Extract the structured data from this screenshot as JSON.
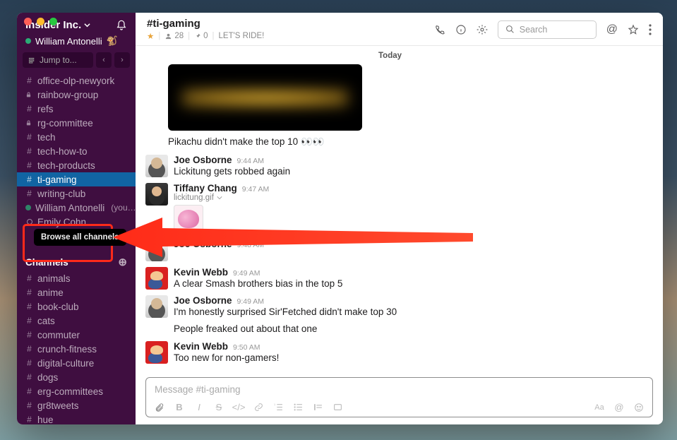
{
  "workspace": {
    "name": "Insider Inc.",
    "user": "William Antonelli"
  },
  "jump": {
    "placeholder": "Jump to..."
  },
  "sidebar_top": [
    {
      "prefix": "#",
      "name": "office-olp-newyork"
    },
    {
      "prefix": "lock",
      "name": "rainbow-group"
    },
    {
      "prefix": "#",
      "name": "refs"
    },
    {
      "prefix": "lock",
      "name": "rg-committee"
    },
    {
      "prefix": "#",
      "name": "tech"
    },
    {
      "prefix": "#",
      "name": "tech-how-to"
    },
    {
      "prefix": "#",
      "name": "tech-products"
    },
    {
      "prefix": "#",
      "name": "ti-gaming",
      "active": true
    },
    {
      "prefix": "#",
      "name": "writing-club"
    },
    {
      "prefix": "presence",
      "name": "William Antonelli",
      "suffix": "(you…  🐒"
    },
    {
      "prefix": "away",
      "name": "Emily Cohn"
    }
  ],
  "tooltip": "Browse all channels",
  "channels_header": "Channels",
  "sidebar_channels": [
    {
      "prefix": "#",
      "name": "animals"
    },
    {
      "prefix": "#",
      "name": "anime"
    },
    {
      "prefix": "#",
      "name": "book-club"
    },
    {
      "prefix": "#",
      "name": "cats"
    },
    {
      "prefix": "#",
      "name": "commuter"
    },
    {
      "prefix": "#",
      "name": "crunch-fitness"
    },
    {
      "prefix": "#",
      "name": "digital-culture"
    },
    {
      "prefix": "#",
      "name": "dogs"
    },
    {
      "prefix": "#",
      "name": "erg-committees"
    },
    {
      "prefix": "#",
      "name": "gr8tweets"
    },
    {
      "prefix": "#",
      "name": "hue"
    }
  ],
  "channel": {
    "title": "#ti-gaming",
    "members": "28",
    "pins": "0",
    "topic": "LET'S RIDE!",
    "search_placeholder": "Search"
  },
  "divider": "Today",
  "below_media": "Pikachu didn't make the top 10 👀👀",
  "messages": [
    {
      "author": "Joe Osborne",
      "time": "9:44 AM",
      "text": "Lickitung gets robbed again",
      "avatar": "joe"
    },
    {
      "author": "Tiffany Chang",
      "time": "9:47 AM",
      "sub": "lickitung.gif",
      "gif": true,
      "avatar": "tiff"
    },
    {
      "author": "Joe Osborne",
      "time": "9:48 AM",
      "text": "",
      "avatar": "joe"
    },
    {
      "author": "Kevin Webb",
      "time": "9:49 AM",
      "text": "A clear Smash brothers bias in the top 5",
      "avatar": "kevin"
    },
    {
      "author": "Joe Osborne",
      "time": "9:49 AM",
      "text": "I'm honestly surprised Sir'Fetched didn't make top 30",
      "followup": "People freaked out about that one",
      "avatar": "joe"
    },
    {
      "author": "Kevin Webb",
      "time": "9:50 AM",
      "text": "Too new for non-gamers!",
      "avatar": "kevin"
    }
  ],
  "composer": {
    "placeholder": "Message #ti-gaming"
  }
}
